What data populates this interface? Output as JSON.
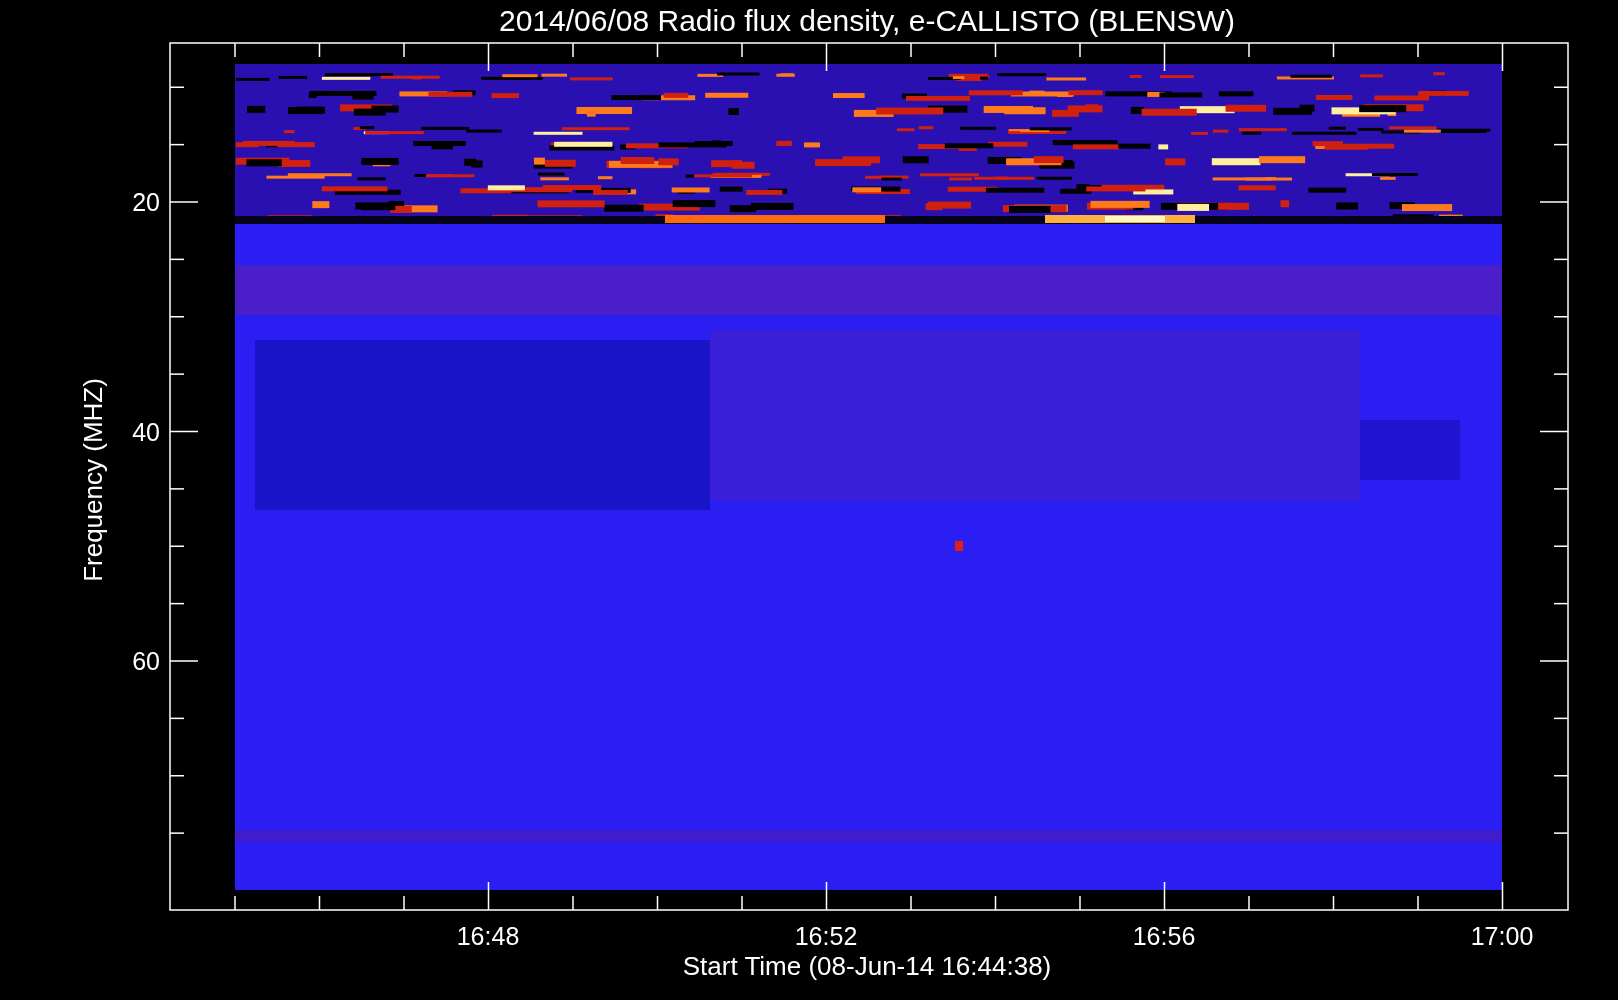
{
  "title": "2014/06/08  Radio flux density, e-CALLISTO (BLENSW)",
  "y_axis": {
    "label": "Frequency (MHZ)",
    "ticks": [
      "20",
      "40",
      "60"
    ]
  },
  "x_axis": {
    "label": "Start Time (08-Jun-14 16:44:38)",
    "ticks": [
      "16:48",
      "16:52",
      "16:56",
      "17:00"
    ]
  }
}
